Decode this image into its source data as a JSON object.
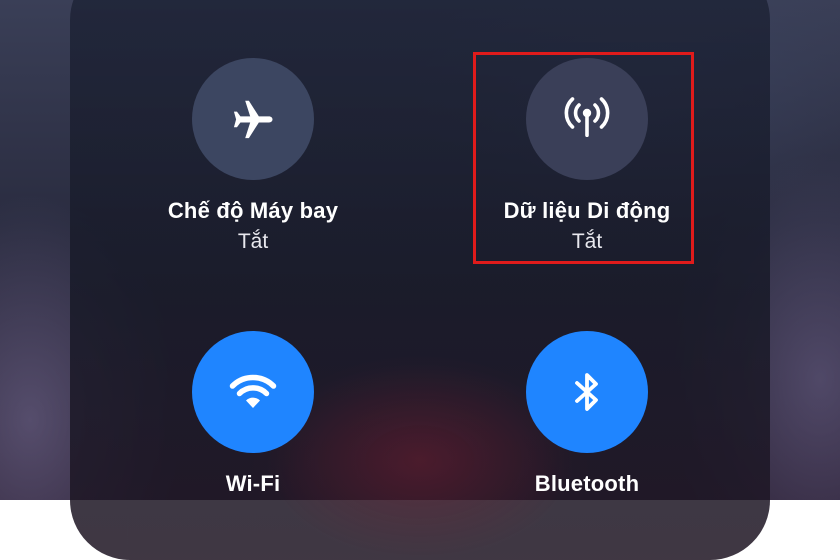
{
  "controls": [
    {
      "label": "Chế độ Máy bay",
      "status": "Tắt",
      "icon": "airplane-icon",
      "state": "off"
    },
    {
      "label": "Dữ liệu Di động",
      "status": "Tắt",
      "icon": "antenna-icon",
      "state": "off"
    },
    {
      "label": "Wi-Fi",
      "icon": "wifi-icon",
      "state": "on"
    },
    {
      "label": "Bluetooth",
      "icon": "bluetooth-icon",
      "state": "on"
    }
  ],
  "colors": {
    "active_blue": "#1f85ff",
    "inactive_gray": "#3c4661",
    "highlight_red": "#e01b1b"
  }
}
